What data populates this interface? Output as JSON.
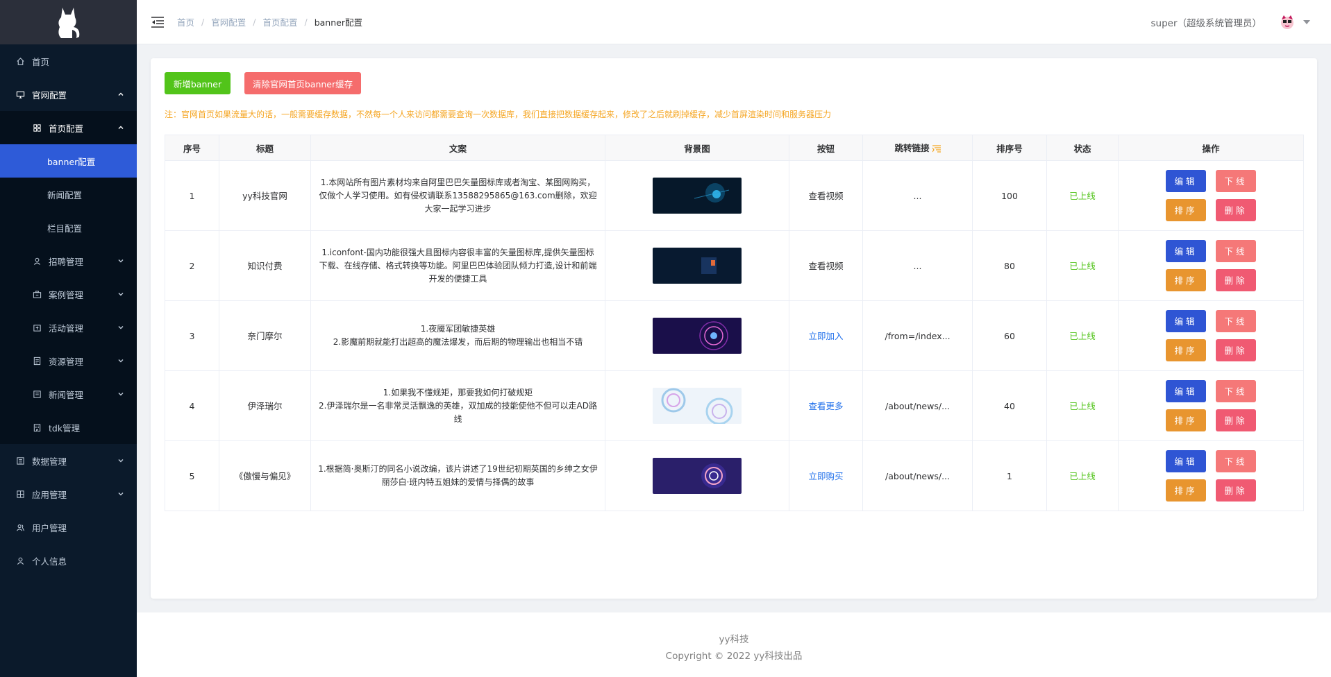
{
  "sidebar": {
    "items": [
      {
        "label": "首页"
      },
      {
        "label": "官网配置"
      },
      {
        "label": "首页配置"
      },
      {
        "label": "banner配置"
      },
      {
        "label": "新闻配置"
      },
      {
        "label": "栏目配置"
      },
      {
        "label": "招聘管理"
      },
      {
        "label": "案例管理"
      },
      {
        "label": "活动管理"
      },
      {
        "label": "资源管理"
      },
      {
        "label": "新闻管理"
      },
      {
        "label": "tdk管理"
      },
      {
        "label": "数据管理"
      },
      {
        "label": "应用管理"
      },
      {
        "label": "用户管理"
      },
      {
        "label": "个人信息"
      }
    ]
  },
  "header": {
    "breadcrumb": [
      "首页",
      "官网配置",
      "首页配置",
      "banner配置"
    ],
    "user": "super（超级系统管理员）"
  },
  "toolbar": {
    "add_label": "新增banner",
    "clear_label": "清除官网首页banner缓存",
    "notice": "注：官网首页如果流量大的话，一般需要缓存数据，不然每一个人来访问都需要查询一次数据库，我们直接把数据缓存起来，修改了之后就刷掉缓存，减少首屏渲染时间和服务器压力"
  },
  "table": {
    "columns": [
      "序号",
      "标题",
      "文案",
      "背景图",
      "按钮",
      "跳转链接",
      "排序号",
      "状态",
      "操作"
    ],
    "ops": {
      "edit": "编辑",
      "down": "下线",
      "sort": "排序",
      "del": "删除"
    },
    "rows": [
      {
        "idx": "1",
        "title": "yy科技官网",
        "copy": "1.本网站所有图片素材均来自阿里巴巴矢量图标库或者淘宝、某图网购买，仅做个人学习使用。如有侵权请联系13588295865@163.com删除，欢迎大家一起学习进步",
        "button": "查看视频",
        "link": "...",
        "sort": "100",
        "status": "已上线"
      },
      {
        "idx": "2",
        "title": "知识付费",
        "copy": "1.iconfont-国内功能很强大且图标内容很丰富的矢量图标库,提供矢量图标下载、在线存储、格式转换等功能。阿里巴巴体验团队倾力打造,设计和前端开发的便捷工具",
        "button": "查看视频",
        "link": "...",
        "sort": "80",
        "status": "已上线"
      },
      {
        "idx": "3",
        "title": "奈门摩尔",
        "copy": "1.夜魇军团敏捷英雄\n2.影魔前期就能打出超高的魔法爆发，而后期的物理输出也相当不错",
        "button": "立即加入",
        "link": "/from=/index...",
        "sort": "60",
        "status": "已上线"
      },
      {
        "idx": "4",
        "title": "伊泽瑞尔",
        "copy": "1.如果我不懂规矩，那要我如何打破规矩\n2.伊泽瑞尔是一名非常灵活飘逸的英雄，双加成的技能使他不但可以走AD路线",
        "button": "查看更多",
        "link": "/about/news/...",
        "sort": "40",
        "status": "已上线"
      },
      {
        "idx": "5",
        "title": "《傲慢与偏见》",
        "copy": "1.根据简·奥斯汀的同名小说改编，该片讲述了19世纪初期英国的乡绅之女伊丽莎白·班内特五姐妹的爱情与择偶的故事",
        "button": "立即购买",
        "link": "/about/news/...",
        "sort": "1",
        "status": "已上线"
      }
    ]
  },
  "footer": {
    "line1": "yy科技",
    "line2": "Copyright © 2022 yy科技出品"
  },
  "colors": {
    "sidebar_bg": "#0b1a2b",
    "active": "#2e5bd8",
    "success": "#52c41a",
    "danger": "#f56c6c",
    "warning": "#f5a623",
    "link": "#1f6feb"
  }
}
